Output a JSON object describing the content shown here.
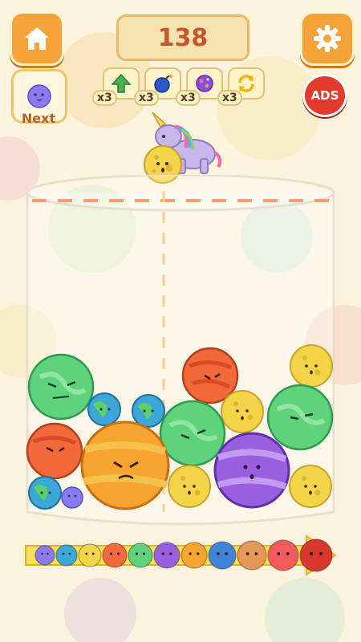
{
  "score": "138",
  "next": {
    "label": "Next",
    "color": "#8a7cf0"
  },
  "powerups": [
    {
      "name": "upgrade",
      "icon": "up-arrow-icon",
      "count": "x3",
      "color": "#4caf50"
    },
    {
      "name": "bomb",
      "icon": "bomb-icon",
      "count": "x3",
      "color": "#2a58c9"
    },
    {
      "name": "shake",
      "icon": "planet-swirl-icon",
      "count": "x3",
      "color": "#8a4fd8"
    },
    {
      "name": "refresh",
      "icon": "refresh-icon",
      "count": "x3",
      "color": "#f4b400"
    }
  ],
  "ads_label": "ADS",
  "held_ball": {
    "name": "moon-yellow",
    "color": "#f4d54a"
  },
  "evolution": [
    {
      "name": "small-purple",
      "color": "#8a7cf0"
    },
    {
      "name": "earth",
      "color": "#3da8d8"
    },
    {
      "name": "moon-yellow",
      "color": "#f4d54a"
    },
    {
      "name": "mars-red",
      "color": "#f26a3b"
    },
    {
      "name": "green-planet",
      "color": "#5fd27c"
    },
    {
      "name": "purple-planet",
      "color": "#9a5ee0"
    },
    {
      "name": "orange-planet",
      "color": "#f7a530"
    },
    {
      "name": "blue-planet",
      "color": "#3f84d9"
    },
    {
      "name": "jupiter",
      "color": "#e6985a"
    },
    {
      "name": "pink-red",
      "color": "#f05a5a"
    },
    {
      "name": "red-giant",
      "color": "#d8372d"
    }
  ]
}
